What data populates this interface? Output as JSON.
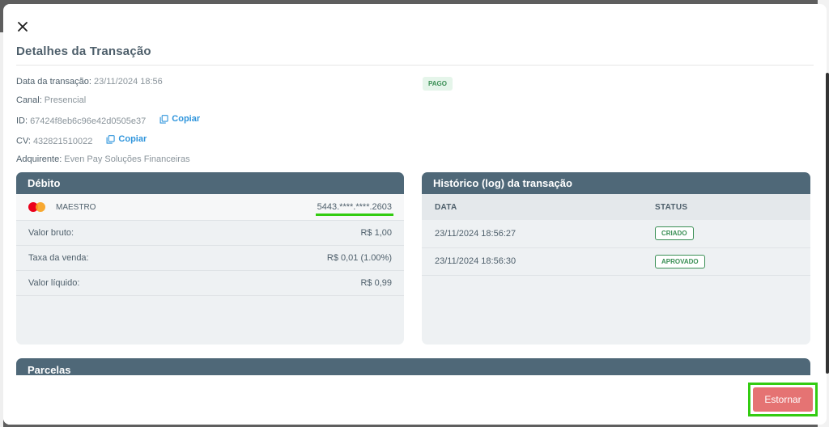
{
  "modal": {
    "title": "Detalhes da Transação"
  },
  "info": {
    "date_label": "Data da transação:",
    "date_value": "23/11/2024 18:56",
    "channel_label": "Canal:",
    "channel_value": "Presencial",
    "id_label": "ID:",
    "id_value": "67424f8eb6c96e42d0505e37",
    "cv_label": "CV:",
    "cv_value": "432821510022",
    "acquirer_label": "Adquirente:",
    "acquirer_value": "Even Pay Soluções Financeiras",
    "copy_label": "Copiar",
    "status_badge": "PAGO"
  },
  "debit": {
    "title": "Débito",
    "brand": "MAESTRO",
    "card_number": "5443.****.****.2603",
    "rows": [
      {
        "label": "Valor bruto:",
        "value": "R$ 1,00"
      },
      {
        "label": "Taxa da venda:",
        "value": "R$ 0,01 (1.00%)"
      },
      {
        "label": "Valor líquido:",
        "value": "R$ 0,99"
      }
    ]
  },
  "history": {
    "title": "Histórico (log) da transação",
    "columns": [
      "DATA",
      "STATUS"
    ],
    "rows": [
      {
        "date": "23/11/2024 18:56:27",
        "status": "CRIADO"
      },
      {
        "date": "23/11/2024 18:56:30",
        "status": "APROVADO"
      }
    ]
  },
  "parcelas": {
    "title": "Parcelas"
  },
  "footer": {
    "estornar_label": "Estornar"
  },
  "colors": {
    "header": "#4f6878",
    "accent_blue": "#2f95dc",
    "status_green": "#3a8f55",
    "estornar": "#e57373",
    "highlight": "#33cc11"
  }
}
